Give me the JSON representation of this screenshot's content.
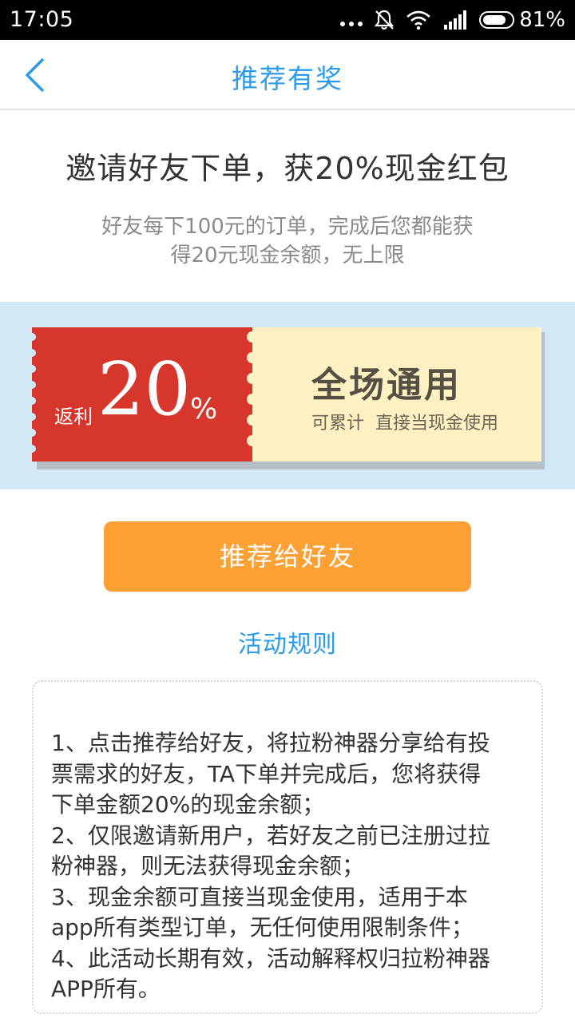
{
  "status_bar": {
    "time": "17:05",
    "battery_percent": "81%",
    "battery_level": 0.81,
    "icons": [
      "more-dots-icon",
      "mute-bell-icon",
      "wifi-icon",
      "signal-icon",
      "battery-icon"
    ]
  },
  "nav": {
    "title": "推荐有奖",
    "back_icon": "chevron-left-icon"
  },
  "headline": {
    "title": "邀请好友下单，获20%现金红包",
    "subtitle_line1": "好友每下100元的订单，完成后您都能获",
    "subtitle_line2": "得20元现金余额，无上限"
  },
  "coupon": {
    "rebate_label": "返利",
    "rebate_value": "20",
    "rebate_unit": "%",
    "title": "全场通用",
    "subtitle": "可累计  直接当现金使用"
  },
  "share_button": {
    "label": "推荐给好友"
  },
  "rules": {
    "title": "活动规则",
    "lines": [
      "1、点击推荐给好友，将拉粉神器分享给有投",
      "票需求的好友，TA下单并完成后，您将获得",
      "下单金额20%的现金余额；",
      "2、仅限邀请新用户，若好友之前已注册过拉",
      "粉神器，则无法获得现金余额；",
      "3、现金余额可直接当现金使用，适用于本",
      "app所有类型订单，无任何使用限制条件；",
      "4、此活动长期有效，活动解释权归拉粉神器",
      "APP所有。"
    ]
  },
  "colors": {
    "accent_blue": "#2b9be8",
    "coupon_red": "#d6362b",
    "coupon_cream": "#fdf0c2",
    "band_blue": "#d3e8f6",
    "button_orange": "#ffa034"
  }
}
